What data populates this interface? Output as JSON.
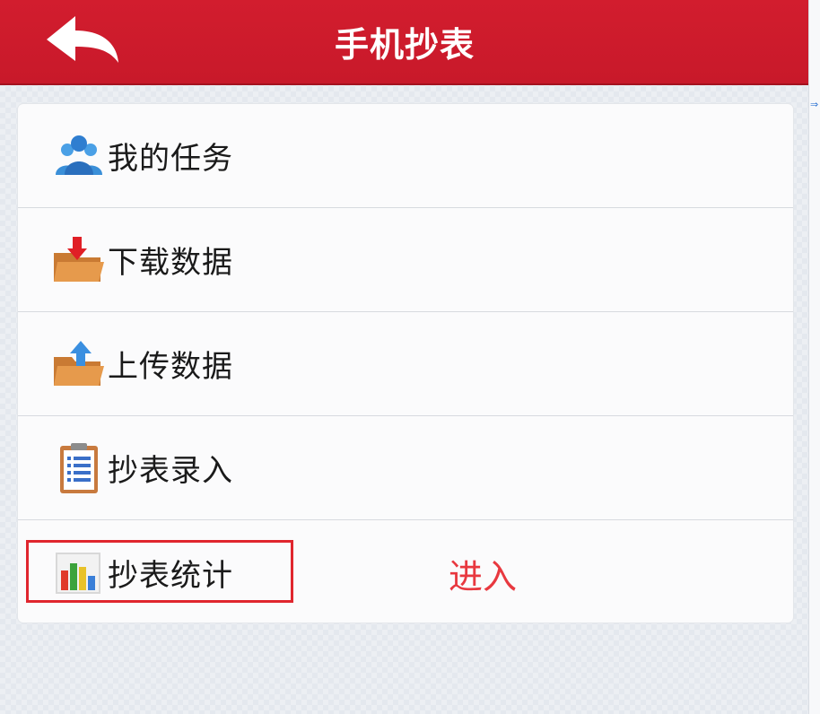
{
  "header": {
    "title": "手机抄表",
    "back_icon": "back-arrow-icon",
    "color": "#cf1b2c"
  },
  "menu": {
    "items": [
      {
        "label": "我的任务",
        "icon": "users-icon"
      },
      {
        "label": "下载数据",
        "icon": "folder-download-icon"
      },
      {
        "label": "上传数据",
        "icon": "folder-upload-icon"
      },
      {
        "label": "抄表录入",
        "icon": "clipboard-icon"
      },
      {
        "label": "抄表统计",
        "icon": "bar-chart-icon"
      }
    ]
  },
  "annotation": {
    "text": "进入",
    "color": "#e8383f",
    "box_color": "#e0262e"
  }
}
